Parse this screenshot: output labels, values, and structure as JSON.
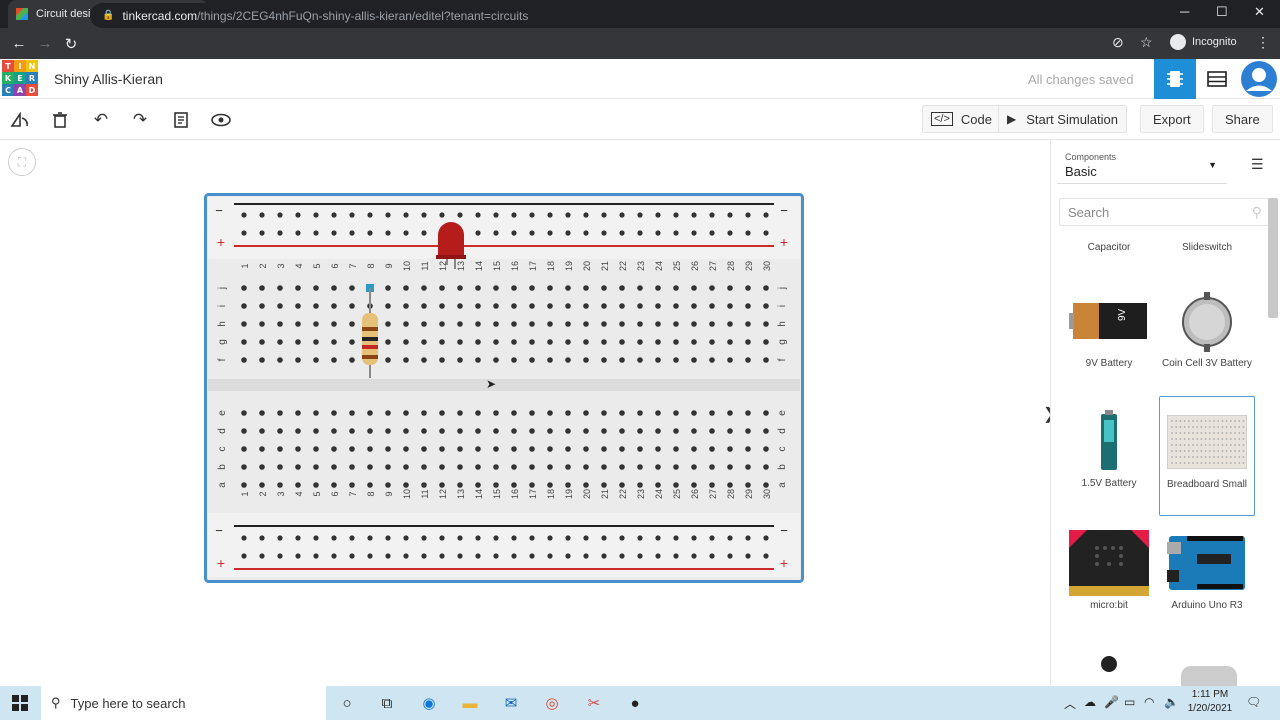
{
  "browser": {
    "tab_title": "Circuit design Shiny Allis-Kieran |",
    "url_host": "tinkercad.com",
    "url_path": "/things/2CEG4nhFuQn-shiny-allis-kieran/editel?tenant=circuits",
    "incognito_label": "Incognito"
  },
  "logo_letters": [
    "T",
    "I",
    "N",
    "K",
    "E",
    "R",
    "C",
    "A",
    "D"
  ],
  "logo_colors": [
    "#e74c3c",
    "#f39c12",
    "#f1c40f",
    "#27ae60",
    "#16a085",
    "#2980b9",
    "#2980b9",
    "#8e44ad",
    "#e74c3c"
  ],
  "header": {
    "project_name": "Shiny Allis-Kieran",
    "save_status": "All changes saved"
  },
  "toolbar": {
    "code_label": "Code",
    "start_simulation_label": "Start Simulation",
    "export_label": "Export",
    "share_label": "Share"
  },
  "breadboard": {
    "columns": [
      "1",
      "2",
      "3",
      "4",
      "5",
      "6",
      "7",
      "8",
      "9",
      "10",
      "11",
      "12",
      "13",
      "14",
      "15",
      "16",
      "17",
      "18",
      "19",
      "20",
      "21",
      "22",
      "23",
      "24",
      "25",
      "26",
      "27",
      "28",
      "29",
      "30"
    ],
    "top_rows": [
      "j",
      "i",
      "h",
      "g",
      "f"
    ],
    "bottom_rows": [
      "e",
      "d",
      "c",
      "b",
      "a"
    ],
    "rail_minus": "−",
    "rail_plus": "+"
  },
  "panel": {
    "dropdown_label": "Components",
    "dropdown_value": "Basic",
    "search_placeholder": "Search",
    "components": [
      {
        "name": "Capacitor"
      },
      {
        "name": "Slideswitch"
      },
      {
        "name": "9V Battery"
      },
      {
        "name": "Coin Cell 3V Battery"
      },
      {
        "name": "1.5V Battery"
      },
      {
        "name": "Breadboard Small",
        "selected": true
      },
      {
        "name": "micro:bit"
      },
      {
        "name": "Arduino Uno R3"
      }
    ]
  },
  "taskbar": {
    "search_placeholder": "Type here to search",
    "time": "1:11 PM",
    "date": "1/20/2021"
  },
  "colors": {
    "accent_blue": "#1e8fd6",
    "breadboard_border": "#4a90c8",
    "led_red": "#b51d1d",
    "rail_red": "#cc2b2b"
  }
}
